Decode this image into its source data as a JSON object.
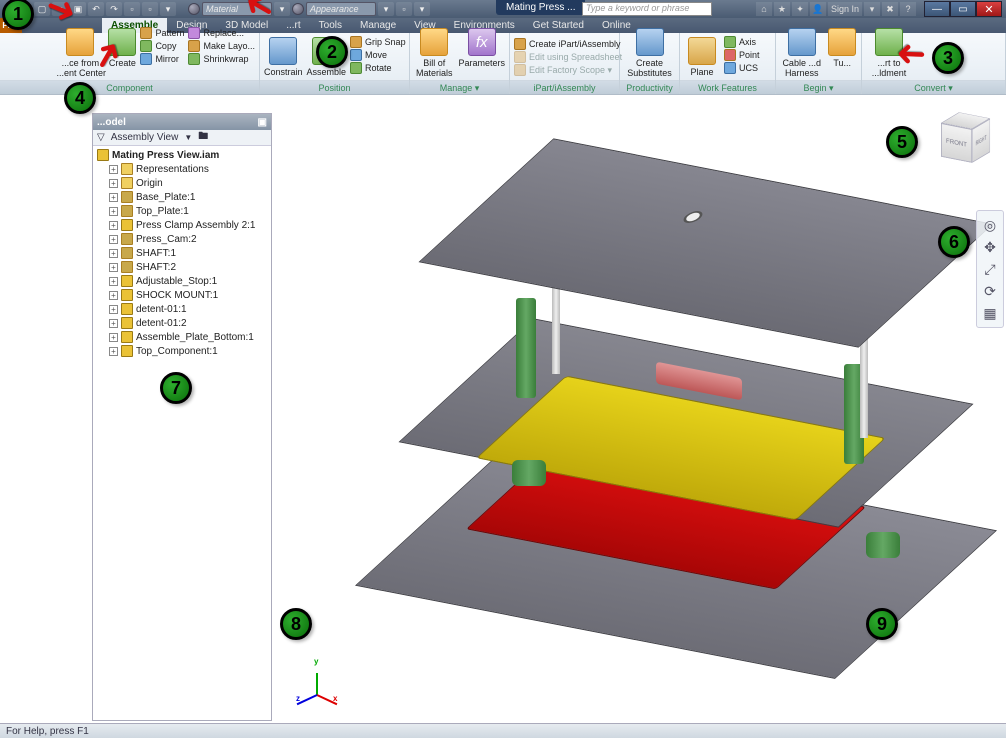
{
  "title": {
    "doc_tab": "Mating Press ..."
  },
  "search": {
    "placeholder": "Type a keyword or phrase"
  },
  "combos": {
    "material": "Material",
    "appearance": "Appearance"
  },
  "signin": {
    "label": "Sign In"
  },
  "appbtn": "PRO",
  "tabs": {
    "t0": "Assemble",
    "t1": "Design",
    "t2": "3D Model",
    "t3": "...rt",
    "t4": "Tools",
    "t5": "Manage",
    "t6": "View",
    "t7": "Environments",
    "t8": "Get Started",
    "t9": "Online"
  },
  "ribbon": {
    "panels": {
      "component": {
        "title": "Component",
        "place": "...ce from\n...ent Center",
        "create": "Create",
        "pattern": "Pattern",
        "copy": "Copy",
        "mirror": "Mirror",
        "replace": "Replace...",
        "makelayout": "Make Layo...",
        "shrinkwrap": "Shrinkwrap"
      },
      "position": {
        "title": "Position",
        "constrain": "Constrain",
        "assemble": "Assemble",
        "grip": "Grip Snap",
        "move": "Move",
        "rotate": "Rotate"
      },
      "manage": {
        "title": "Manage ▾",
        "bom": "Bill of\nMaterials",
        "params": "Parameters"
      },
      "ipart": {
        "title": "iPart/iAssembly",
        "create": "Create iPart/iAssembly",
        "edit1": "Edit using Spreadsheet",
        "edit2": "Edit Factory Scope  ▾"
      },
      "prod": {
        "title": "Productivity",
        "sub": "Create\nSubstitutes"
      },
      "workfeat": {
        "title": "Work Features",
        "plane": "Plane",
        "axis": "Axis",
        "point": "Point",
        "ucs": "UCS"
      },
      "begin": {
        "title": "Begin ▾",
        "cable": "Cable ...d\nHarness",
        "tu": "Tu..."
      },
      "convert": {
        "title": "Convert ▾",
        "c": "...rt to\n...ldment"
      }
    }
  },
  "browser": {
    "head": "...odel",
    "filter_label": "Assembly View",
    "root": "Mating Press View.iam",
    "items": {
      "i0": "Representations",
      "i1": "Origin",
      "i2": "Base_Plate:1",
      "i3": "Top_Plate:1",
      "i4": "Press Clamp Assembly 2:1",
      "i5": "Press_Cam:2",
      "i6": "SHAFT:1",
      "i7": "SHAFT:2",
      "i8": "Adjustable_Stop:1",
      "i9": "SHOCK MOUNT:1",
      "i10": "detent-01:1",
      "i11": "detent-01:2",
      "i12": "Assemble_Plate_Bottom:1",
      "i13": "Top_Component:1"
    }
  },
  "viewcube": {
    "front": "FRONT",
    "right": "RIGHT",
    "top": ""
  },
  "triad": {
    "x": "x",
    "y": "y",
    "z": "z"
  },
  "status": {
    "help": "For Help, press F1"
  },
  "callouts": {
    "c1": "1",
    "c2": "2",
    "c3": "3",
    "c4": "4",
    "c5": "5",
    "c6": "6",
    "c7": "7",
    "c8": "8",
    "c9": "9"
  }
}
